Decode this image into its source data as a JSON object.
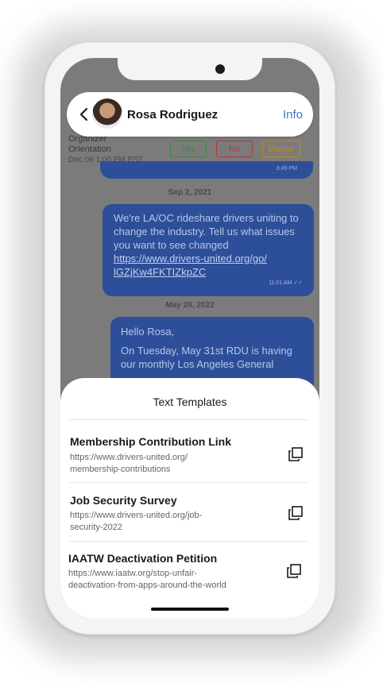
{
  "header": {
    "contact_name": "Rosa Rodriguez",
    "info_label": "Info",
    "back_icon": "chevron-left-icon"
  },
  "event": {
    "title_line1": "Organizer",
    "title_line2": "Orientation",
    "datetime": "Dec 06 1:00 PM PST",
    "rsvp": {
      "yes": "Yes",
      "no": "No",
      "maybe": "Maybe"
    },
    "colors": {
      "yes": "#3a8a3a",
      "no": "#b23a3a",
      "maybe": "#c08a1a"
    }
  },
  "messages": {
    "top_time": "3:45 PM",
    "sep1": "Sep 2, 2021",
    "msg1_text": "We're LA/OC rideshare drivers uniting to change the industry. Tell us what issues you want to see changed",
    "msg1_link1": "https://www.drivers-united.org/go/",
    "msg1_link2": "lGZjKw4FKTIZkpZC",
    "msg1_time": "11:01 AM",
    "sep2": "May 28, 2022",
    "msg2_line1": "Hello Rosa,",
    "msg2_line2": "On Tuesday, May 31st RDU is having our monthly Los Angeles General"
  },
  "templates": {
    "title": "Text Templates",
    "items": [
      {
        "name": "Membership Contribution Link",
        "url_line1": "https://www.drivers-united.org/",
        "url_line2": "membership-contributions"
      },
      {
        "name": "Job Security Survey",
        "url_line1": "https://www.drivers-united.org/job-",
        "url_line2": "security-2022"
      },
      {
        "name": "IAATW Deactivation Petition",
        "url_line1": "https://www.iaatw.org/stop-unfair-",
        "url_line2": "deactivation-from-apps-around-the-world"
      }
    ]
  },
  "colors": {
    "accent": "#4a72c6",
    "bubble": "#2d4f9a",
    "overlay": "#7b7b7b"
  }
}
